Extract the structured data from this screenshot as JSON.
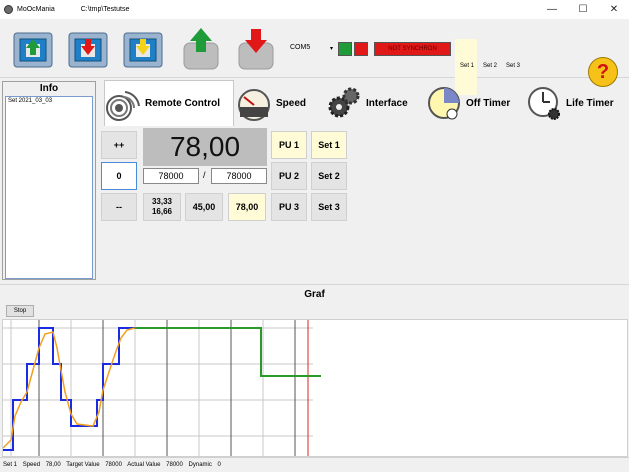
{
  "window": {
    "app_title": "MoOcMania",
    "path": "C:\\tmp\\Testutse",
    "minimize": "—",
    "maximize": "☐",
    "close": "✕"
  },
  "toolbar": {
    "com_port": "COM5",
    "com_arrow": "▾",
    "sync_status": "NOT SYNCHRON",
    "sets": [
      "Set 1",
      "Set 2",
      "Set 3"
    ],
    "help": "?",
    "colors": {
      "green": "#1f9b3a",
      "red": "#e01818",
      "help_yellow": "#f6c21a"
    }
  },
  "info": {
    "title": "Info",
    "items": [
      "Set 2021_03_03"
    ]
  },
  "tabs": [
    {
      "label": "Remote Control",
      "icon": "remote-control-icon",
      "active": true
    },
    {
      "label": "Speed",
      "icon": "speed-gauge-icon",
      "active": false
    },
    {
      "label": "Interface",
      "icon": "gears-icon",
      "active": false
    },
    {
      "label": "Off Timer",
      "icon": "off-timer-icon",
      "active": false
    },
    {
      "label": "Life Timer",
      "icon": "life-timer-icon",
      "active": false
    }
  ],
  "remote": {
    "plusplus": "++",
    "zero": "0",
    "minusminus": "--",
    "big_value": "78,00",
    "field_a": "78000",
    "separator": "/",
    "field_b": "78000",
    "preset_stack_top": "33,33",
    "preset_stack_bottom": "16,66",
    "preset_mid": "45,00",
    "preset_selected": "78,00",
    "pu": [
      "PU 1",
      "PU 2",
      "PU 3"
    ],
    "sets": [
      "Set 1",
      "Set 2",
      "Set 3"
    ]
  },
  "graf": {
    "title": "Graf",
    "stop_label": "Stop"
  },
  "status": {
    "set": "Set 1",
    "speed_label": "Speed",
    "speed_value": "78,00",
    "target_label": "Target Value",
    "target_value": "78000",
    "actual_label": "Actual Value",
    "actual_value": "78000",
    "dynamic_label": "Dynamic",
    "dynamic_value": "0"
  }
}
